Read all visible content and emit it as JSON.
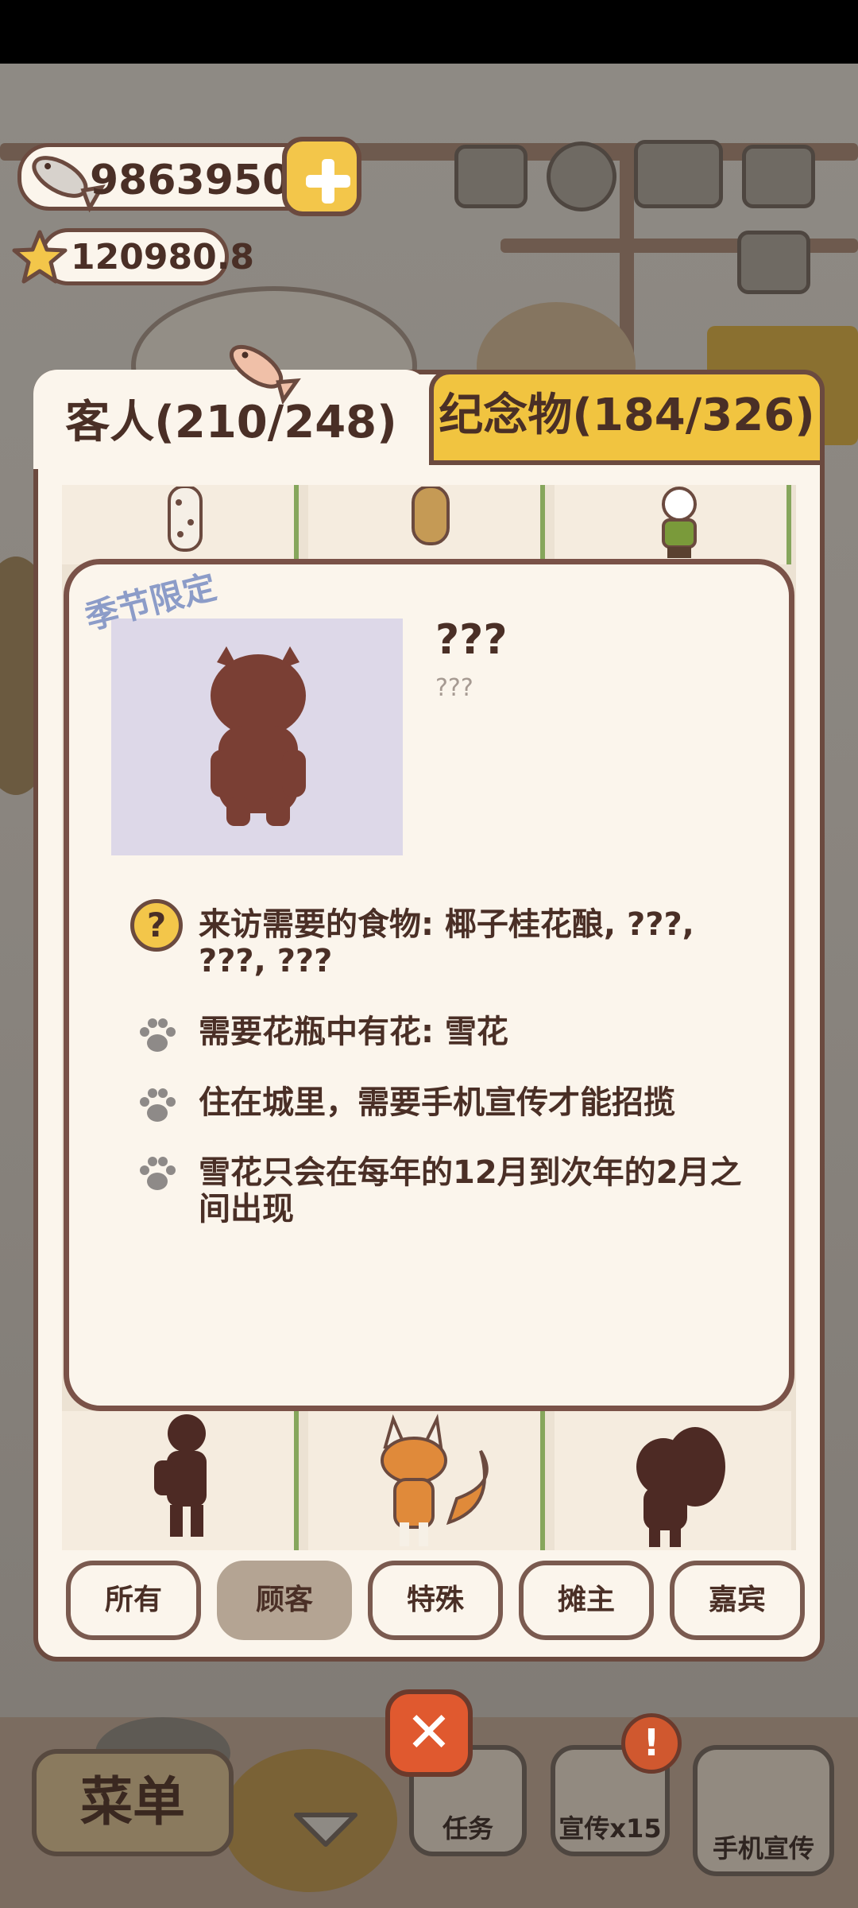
{
  "currency": {
    "fish": "9863950",
    "stars": "120980.8"
  },
  "tabs": [
    {
      "label": "客人(210/248)",
      "active": true
    },
    {
      "label": "纪念物(184/326)",
      "active": false
    }
  ],
  "detail": {
    "seasonal_tag": "季节限定",
    "name": "???",
    "subname": "???",
    "requirements": [
      {
        "icon": "question-icon",
        "text": "来访需要的食物: 椰子桂花酿, ???, ???, ???"
      },
      {
        "icon": "paw-icon",
        "text": "需要花瓶中有花: 雪花"
      },
      {
        "icon": "paw-icon",
        "text": "住在城里，需要手机宣传才能招揽"
      },
      {
        "icon": "paw-icon",
        "text": "雪花只会在每年的12月到次年的2月之间出现"
      }
    ]
  },
  "filters": [
    {
      "label": "所有",
      "active": false
    },
    {
      "label": "顾客",
      "active": true
    },
    {
      "label": "特殊",
      "active": false
    },
    {
      "label": "摊主",
      "active": false
    },
    {
      "label": "嘉宾",
      "active": false
    }
  ],
  "close": {
    "symbol": "✕"
  },
  "bottom_bar": {
    "menu_label": "菜单",
    "tasks_label": "任务",
    "promo_label": "宣传x15",
    "phone_promo_label": "手机宣传",
    "alert_badge": "!"
  },
  "colors": {
    "card_bg": "#fbf5ec",
    "border_brown": "#6b4a3f",
    "tab_gold": "#f1c440",
    "silhouette": "#7a3f34",
    "seasonal_blue": "#8c9cc8",
    "close_red": "#e0592f"
  }
}
